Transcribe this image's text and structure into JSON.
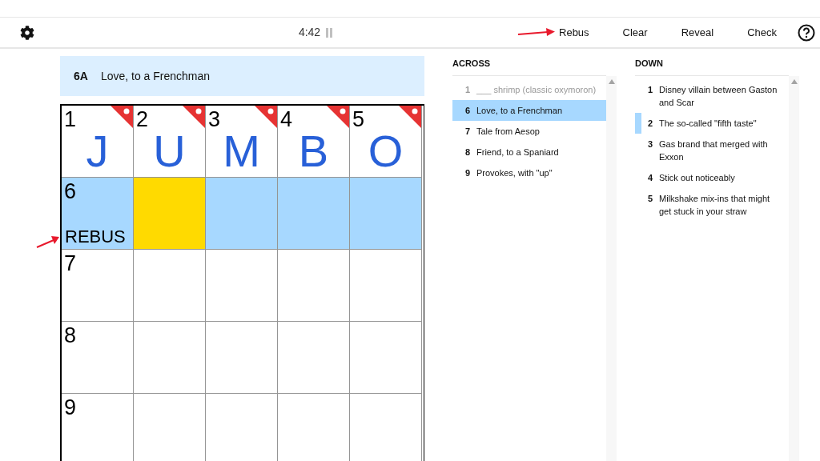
{
  "toolbar": {
    "timer": "4:42",
    "actions": [
      {
        "label": "Rebus",
        "annotated": true
      },
      {
        "label": "Clear",
        "annotated": false
      },
      {
        "label": "Reveal",
        "annotated": false
      },
      {
        "label": "Check",
        "annotated": false
      }
    ]
  },
  "clue_bar": {
    "number": "6A",
    "text": "Love, to a Frenchman"
  },
  "grid": {
    "rows": [
      [
        {
          "number": "1",
          "letter": "J",
          "revealed": true,
          "in_word": false,
          "selected": false
        },
        {
          "number": "2",
          "letter": "U",
          "revealed": true,
          "in_word": false,
          "selected": false
        },
        {
          "number": "3",
          "letter": "M",
          "revealed": true,
          "in_word": false,
          "selected": false
        },
        {
          "number": "4",
          "letter": "B",
          "revealed": true,
          "in_word": false,
          "selected": false
        },
        {
          "number": "5",
          "letter": "O",
          "revealed": true,
          "in_word": false,
          "selected": false
        }
      ],
      [
        {
          "number": "6",
          "rebus": "REBUS",
          "annotated": true,
          "revealed": false,
          "in_word": true,
          "selected": false
        },
        {
          "revealed": false,
          "in_word": true,
          "selected": true
        },
        {
          "revealed": false,
          "in_word": true,
          "selected": false
        },
        {
          "revealed": false,
          "in_word": true,
          "selected": false
        },
        {
          "revealed": false,
          "in_word": true,
          "selected": false
        }
      ],
      [
        {
          "number": "7",
          "revealed": false,
          "in_word": false,
          "selected": false
        },
        {
          "revealed": false,
          "in_word": false,
          "selected": false
        },
        {
          "revealed": false,
          "in_word": false,
          "selected": false
        },
        {
          "revealed": false,
          "in_word": false,
          "selected": false
        },
        {
          "revealed": false,
          "in_word": false,
          "selected": false
        }
      ],
      [
        {
          "number": "8",
          "revealed": false,
          "in_word": false,
          "selected": false
        },
        {
          "revealed": false,
          "in_word": false,
          "selected": false
        },
        {
          "revealed": false,
          "in_word": false,
          "selected": false
        },
        {
          "revealed": false,
          "in_word": false,
          "selected": false
        },
        {
          "revealed": false,
          "in_word": false,
          "selected": false
        }
      ],
      [
        {
          "number": "9",
          "revealed": false,
          "in_word": false,
          "selected": false
        },
        {
          "revealed": false,
          "in_word": false,
          "selected": false
        },
        {
          "revealed": false,
          "in_word": false,
          "selected": false
        },
        {
          "revealed": false,
          "in_word": false,
          "selected": false
        },
        {
          "revealed": false,
          "in_word": false,
          "selected": false
        }
      ]
    ]
  },
  "clue_lists": [
    {
      "title": "ACROSS",
      "clues": [
        {
          "number": "1",
          "text": "___ shrimp (classic oxymoron)",
          "done": true,
          "selected": false,
          "crossing": false
        },
        {
          "number": "6",
          "text": "Love, to a Frenchman",
          "done": false,
          "selected": true,
          "crossing": false
        },
        {
          "number": "7",
          "text": "Tale from Aesop",
          "done": false,
          "selected": false,
          "crossing": false
        },
        {
          "number": "8",
          "text": "Friend, to a Spaniard",
          "done": false,
          "selected": false,
          "crossing": false
        },
        {
          "number": "9",
          "text": "Provokes, with \"up\"",
          "done": false,
          "selected": false,
          "crossing": false
        }
      ]
    },
    {
      "title": "DOWN",
      "clues": [
        {
          "number": "1",
          "text": "Disney villain between Gaston and Scar",
          "done": false,
          "selected": false,
          "crossing": false
        },
        {
          "number": "2",
          "text": "The so-called \"fifth taste\"",
          "done": false,
          "selected": false,
          "crossing": true
        },
        {
          "number": "3",
          "text": "Gas brand that merged with Exxon",
          "done": false,
          "selected": false,
          "crossing": false
        },
        {
          "number": "4",
          "text": "Stick out noticeably",
          "done": false,
          "selected": false,
          "crossing": false
        },
        {
          "number": "5",
          "text": "Milkshake mix-ins that might get stuck in your straw",
          "done": false,
          "selected": false,
          "crossing": false
        }
      ]
    }
  ]
}
